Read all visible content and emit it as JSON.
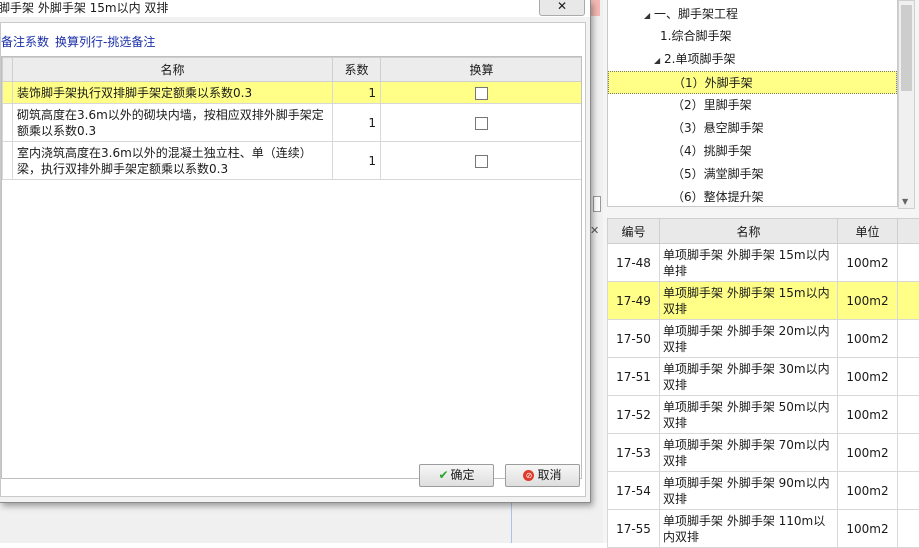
{
  "dialog": {
    "title": "脚手架 外脚手架 15m以内 双排",
    "close_label": "✕",
    "links": [
      "备注系数",
      "换算列行-挑选备注"
    ],
    "columns": [
      "名称",
      "系数",
      "换算"
    ],
    "rows": [
      {
        "name": "装饰脚手架执行双排脚手架定额乘以系数0.3",
        "coef": "1",
        "selected": true
      },
      {
        "name": "砌筑高度在3.6m以外的砌块内墙，按相应双排外脚手架定额乘以系数0.3",
        "coef": "1",
        "selected": false
      },
      {
        "name": "室内浇筑高度在3.6m以外的混凝土独立柱、单（连续）梁，执行双排外脚手架定额乘以系数0.3",
        "coef": "1",
        "selected": false
      }
    ],
    "ok_label": "确定",
    "cancel_label": "取消"
  },
  "tree": {
    "items": [
      {
        "label": "一、脚手架工程",
        "arrow": "◢"
      },
      {
        "label": "1.综合脚手架",
        "arrow": ""
      },
      {
        "label": "2.单项脚手架",
        "arrow": "◢"
      },
      {
        "label": "（1）外脚手架",
        "arrow": ""
      },
      {
        "label": "（2）里脚手架",
        "arrow": ""
      },
      {
        "label": "（3）悬空脚手架",
        "arrow": ""
      },
      {
        "label": "（4）挑脚手架",
        "arrow": ""
      },
      {
        "label": "（5）满堂脚手架",
        "arrow": ""
      },
      {
        "label": "（6）整体提升架",
        "arrow": ""
      }
    ]
  },
  "quota_table": {
    "columns": [
      "编号",
      "名称",
      "单位"
    ],
    "rows": [
      {
        "code": "17-48",
        "name": "单项脚手架 外脚手架 15m以内单排",
        "unit": "100m2",
        "extra": ""
      },
      {
        "code": "17-49",
        "name": "单项脚手架 外脚手架 15m以内双排",
        "unit": "100m2",
        "extra": ""
      },
      {
        "code": "17-50",
        "name": "单项脚手架 外脚手架 20m以内双排",
        "unit": "100m2",
        "extra": ""
      },
      {
        "code": "17-51",
        "name": "单项脚手架 外脚手架 30m以内双排",
        "unit": "100m2",
        "extra": ""
      },
      {
        "code": "17-52",
        "name": "单项脚手架 外脚手架 50m以内双排",
        "unit": "100m2",
        "extra": ""
      },
      {
        "code": "17-53",
        "name": "单项脚手架 外脚手架 70m以内双排",
        "unit": "100m2",
        "extra": ""
      },
      {
        "code": "17-54",
        "name": "单项脚手架 外脚手架 90m以内双排",
        "unit": "100m2",
        "extra": ""
      },
      {
        "code": "17-55",
        "name": "单项脚手架 外脚手架 110m以内双排",
        "unit": "100m2",
        "extra": ""
      }
    ]
  },
  "colors": {
    "highlight": "#ffff88",
    "link": "#1a2fa8"
  }
}
